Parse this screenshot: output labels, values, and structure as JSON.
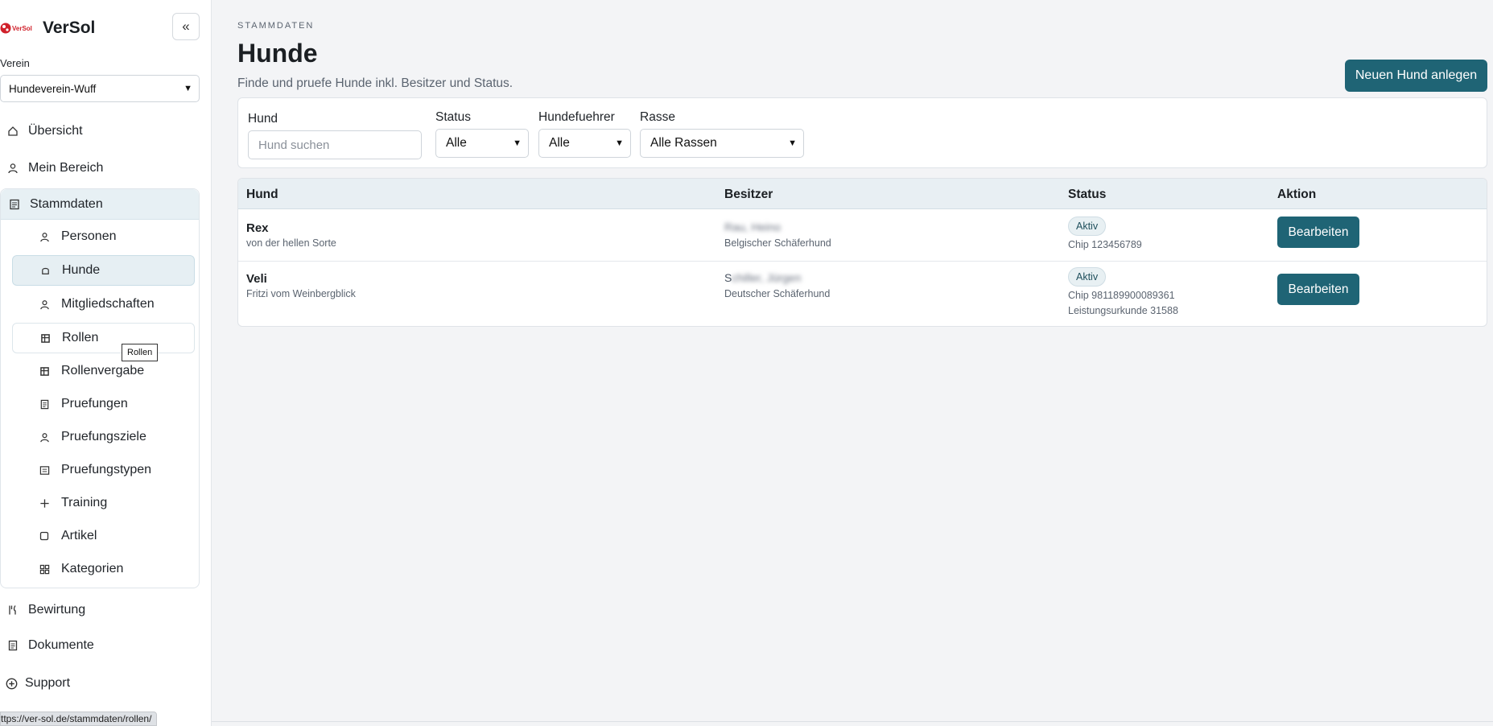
{
  "app": {
    "name": "VerSol",
    "logo_text": "VerSol",
    "verein_label": "Verein",
    "verein_value": "Hundeverein-Wuff",
    "collapse_icon": "double-chevron-left-icon",
    "status_url": "ttps://ver-sol.de/stammdaten/rollen/"
  },
  "nav": {
    "top": [
      {
        "label": "Übersicht",
        "icon": "home-icon"
      },
      {
        "label": "Mein Bereich",
        "icon": "user-icon"
      }
    ],
    "stammdaten": {
      "label": "Stammdaten",
      "icon": "document-icon",
      "items": [
        {
          "label": "Personen",
          "icon": "user-icon"
        },
        {
          "label": "Hunde",
          "icon": "bell-icon"
        },
        {
          "label": "Mitgliedschaften",
          "icon": "user-icon"
        },
        {
          "label": "Rollen",
          "icon": "table-icon"
        },
        {
          "label": "Rollenvergabe",
          "icon": "table-icon"
        },
        {
          "label": "Pruefungen",
          "icon": "document-icon"
        },
        {
          "label": "Pruefungsziele",
          "icon": "user-icon"
        },
        {
          "label": "Pruefungstypen",
          "icon": "list-icon"
        },
        {
          "label": "Training",
          "icon": "plus-icon"
        },
        {
          "label": "Artikel",
          "icon": "square-icon"
        },
        {
          "label": "Kategorien",
          "icon": "grid-icon"
        }
      ]
    },
    "bottom": [
      {
        "label": "Bewirtung",
        "icon": "cutlery-icon"
      },
      {
        "label": "Dokumente",
        "icon": "document-icon"
      },
      {
        "label": "Support",
        "icon": "plus-circle-icon"
      }
    ],
    "tooltip": "Rollen"
  },
  "page": {
    "eyebrow": "STAMMDATEN",
    "title": "Hunde",
    "subtitle": "Finde und pruefe Hunde inkl. Besitzer und Status.",
    "new_button": "Neuen Hund anlegen"
  },
  "filters": {
    "hund_label": "Hund",
    "hund_placeholder": "Hund suchen",
    "status_label": "Status",
    "status_value": "Alle",
    "fuehrer_label": "Hundefuehrer",
    "fuehrer_value": "Alle",
    "rasse_label": "Rasse",
    "rasse_value": "Alle Rassen"
  },
  "table": {
    "headers": [
      "Hund",
      "Besitzer",
      "Status",
      "Aktion"
    ],
    "rows": [
      {
        "name": "Rex",
        "kennel": "von der hellen Sorte",
        "owner_visible": "",
        "owner_blurred": "Rau, Heino",
        "breed": "Belgischer Schäferhund",
        "status": "Aktiv",
        "details": [
          "Chip 123456789"
        ],
        "action": "Bearbeiten"
      },
      {
        "name": "Veli",
        "kennel": "Fritzi vom Weinbergblick",
        "owner_visible": "S",
        "owner_blurred": "chiller, Jürgen",
        "breed": "Deutscher Schäferhund",
        "status": "Aktiv",
        "details": [
          "Chip 981189900089361",
          "Leistungsurkunde 31588"
        ],
        "action": "Bearbeiten"
      }
    ]
  },
  "colors": {
    "accent": "#1f6475",
    "active_bg": "#e6eff3",
    "page_bg": "#f3f4f6"
  }
}
